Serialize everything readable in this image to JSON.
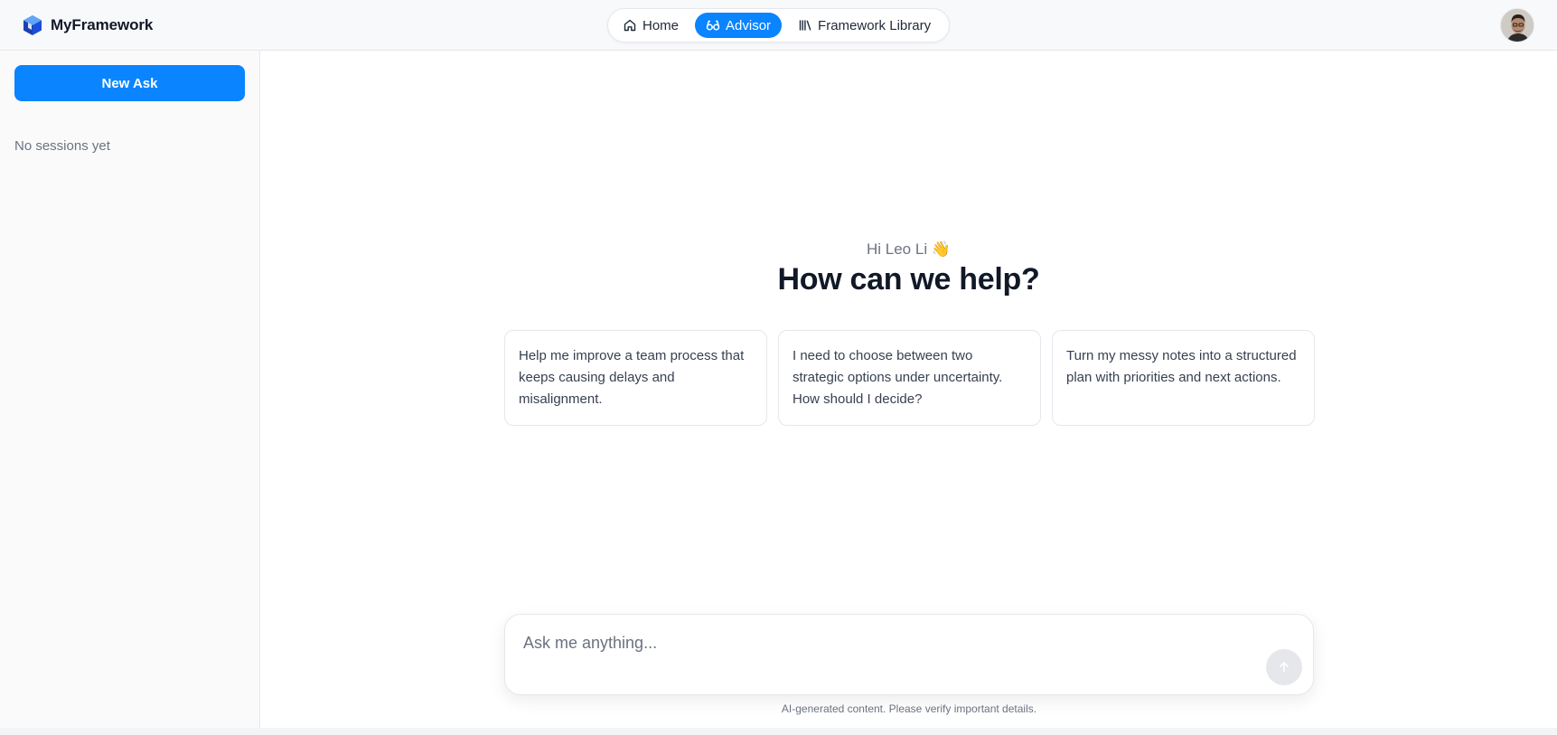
{
  "header": {
    "brand_name": "MyFramework",
    "brand_logo": "cube-logo-icon",
    "nav": [
      {
        "label": "Home",
        "icon": "home-icon",
        "active": false
      },
      {
        "label": "Advisor",
        "icon": "glasses-icon",
        "active": true
      },
      {
        "label": "Framework Library",
        "icon": "library-icon",
        "active": false
      }
    ],
    "avatar": "user-avatar"
  },
  "sidebar": {
    "new_ask_label": "New Ask",
    "empty_text": "No sessions yet"
  },
  "main": {
    "greeting": "Hi Leo Li 👋",
    "headline": "How can we help?",
    "suggestions": [
      "Help me improve a team process that keeps causing delays and misalignment.",
      "I need to choose between two strategic options under uncertainty. How should I decide?",
      "Turn my messy notes into a structured plan with priorities and next actions."
    ],
    "composer": {
      "placeholder": "Ask me anything...",
      "value": "",
      "send_icon": "arrow-up-icon"
    },
    "disclaimer": "AI-generated content. Please verify important details."
  },
  "colors": {
    "accent": "#0a84ff",
    "text_primary": "#111827",
    "text_secondary": "#6b7280",
    "border": "#e5e7eb",
    "sidebar_bg": "#fafafa",
    "header_bg": "#f8f9fb"
  }
}
